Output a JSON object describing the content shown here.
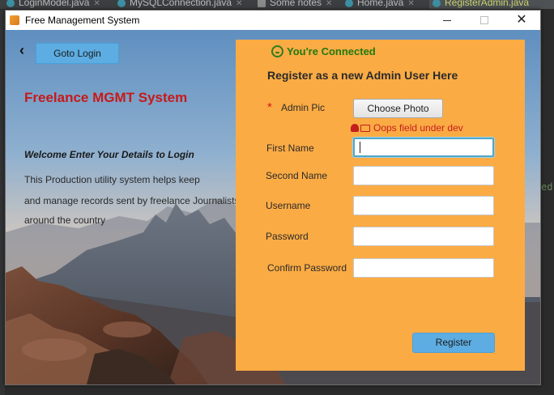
{
  "ide": {
    "tabs": [
      {
        "label": "LoginModel.java"
      },
      {
        "label": "MySQLConnection.java"
      },
      {
        "label": "Some notes"
      },
      {
        "label": "Home.java"
      },
      {
        "label": "RegisterAdmin.java"
      }
    ],
    "code_snippet": "ed\""
  },
  "window": {
    "title": "Free Management System",
    "minimize_icon": "minimize-icon",
    "maximize_icon": "maximize-icon",
    "close_icon": "close-icon",
    "close_glyph": "✕"
  },
  "left": {
    "back_glyph": "‹",
    "goto_login_label": "Goto Login",
    "brand_title": "Freelance MGMT System",
    "welcome": "Welcome Enter Your Details to Login",
    "desc_line1": "This Production utility system helps keep",
    "desc_line2": "and manage records sent by freelance Journalists",
    "desc_line3": "around the country",
    "brand_color": "#c61a1a"
  },
  "register": {
    "status": "You're Connected",
    "status_color": "#1f7a10",
    "heading": "Register as a new Admin User Here",
    "required_mark": "*",
    "admin_pic_label": "Admin Pic",
    "choose_photo_label": "Choose Photo",
    "under_dev_text": "Oops field under dev",
    "first_name_label": "First Name",
    "second_name_label": "Second Name",
    "username_label": "Username",
    "password_label": "Password",
    "confirm_password_label": "Confirm Password",
    "first_name_value": "",
    "second_name_value": "",
    "username_value": "",
    "password_value": "",
    "confirm_password_value": "",
    "register_label": "Register",
    "panel_color": "#fbab44",
    "button_color": "#5dade2"
  }
}
